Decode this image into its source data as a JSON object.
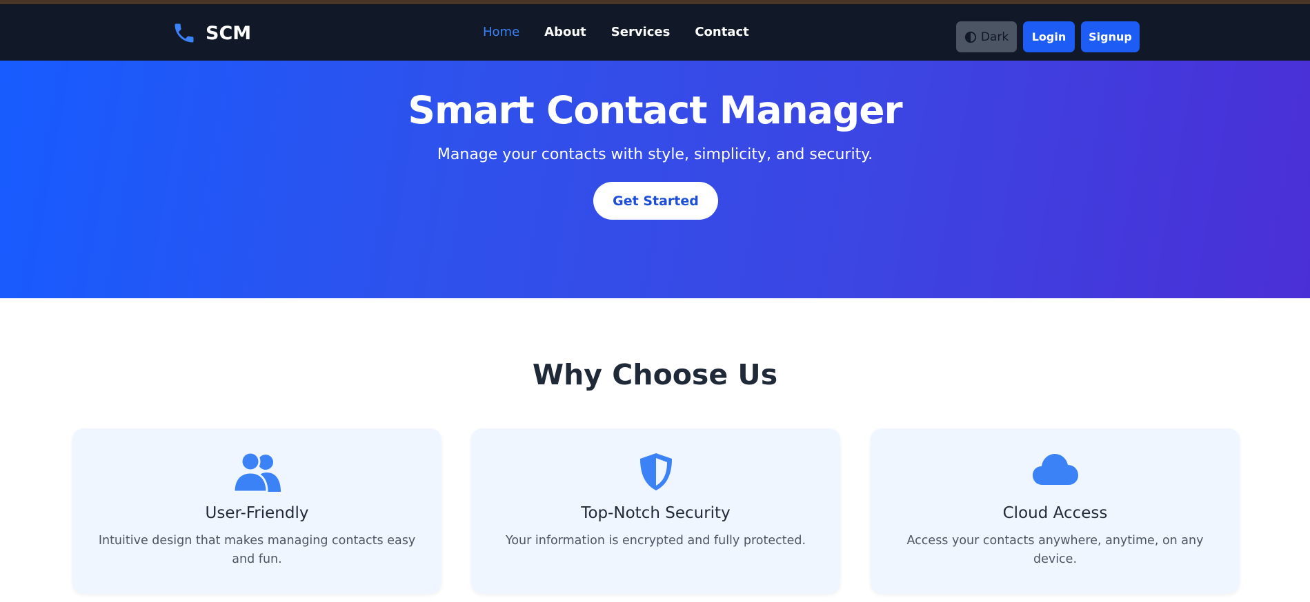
{
  "brand": {
    "name": "SCM",
    "icon": "phone-icon",
    "icon_color": "#3b82f6"
  },
  "nav": {
    "links": [
      {
        "label": "Home",
        "active": true
      },
      {
        "label": "About"
      },
      {
        "label": "Services"
      },
      {
        "label": "Contact"
      }
    ],
    "theme_toggle_label": "Dark",
    "login_label": "Login",
    "signup_label": "Signup"
  },
  "hero": {
    "title": "Smart Contact Manager",
    "subtitle": "Manage your contacts with style, simplicity, and security.",
    "cta_label": "Get Started"
  },
  "features": {
    "title": "Why Choose Us",
    "cards": [
      {
        "icon": "users-icon",
        "title": "User-Friendly",
        "text": "Intuitive design that makes managing contacts easy and fun."
      },
      {
        "icon": "shield-icon",
        "title": "Top-Notch Security",
        "text": "Your information is encrypted and fully protected."
      },
      {
        "icon": "cloud-icon",
        "title": "Cloud Access",
        "text": "Access your contacts anywhere, anytime, on any device."
      }
    ]
  },
  "colors": {
    "navbar_bg": "#111827",
    "accent_blue": "#1d5cf5",
    "hero_gradient_start": "#175cff",
    "hero_gradient_end": "#4a2fd6",
    "card_bg": "#eff6ff",
    "icon_blue": "#3b82f6"
  }
}
